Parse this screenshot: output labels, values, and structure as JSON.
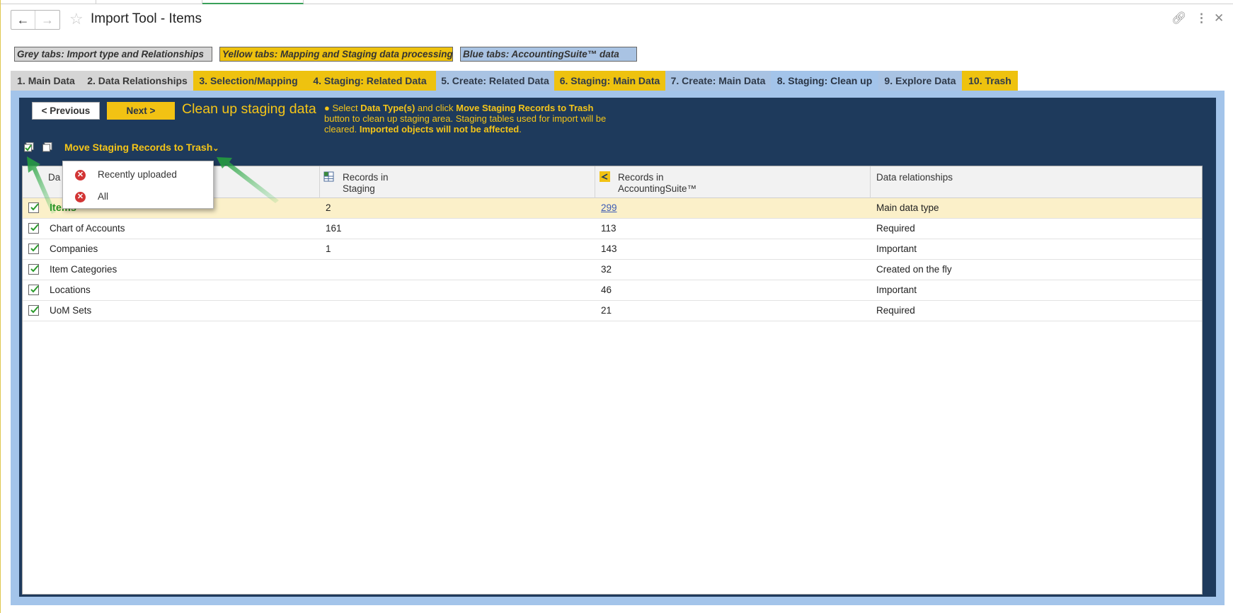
{
  "window": {
    "title": "Import Tool - Items"
  },
  "legend": {
    "grey": "Grey tabs: Import type and Relationships",
    "yellow": "Yellow tabs: Mapping and Staging data processing",
    "blue": "Blue tabs: AccountingSuite™ data"
  },
  "colors": {
    "grey_tab": "#d5d5d5",
    "yellow_tab": "#eec20f",
    "blue_tab": "#a9c3e3",
    "panel": "#1e3a5c",
    "accent": "#f5c518"
  },
  "tabs": [
    {
      "label": "1. Main Data",
      "color": "grey"
    },
    {
      "label": "2. Data Relationships",
      "color": "grey"
    },
    {
      "label": "3. Selection/Mapping",
      "color": "yellow"
    },
    {
      "label": "4. Staging: Related Data",
      "color": "yellow"
    },
    {
      "label": "5. Create: Related Data",
      "color": "blue"
    },
    {
      "label": "6. Staging: Main Data",
      "color": "yellow"
    },
    {
      "label": "7. Create: Main Data",
      "color": "blue"
    },
    {
      "label": "8. Staging: Clean up",
      "color": "active"
    },
    {
      "label": "9. Explore Data",
      "color": "blue"
    },
    {
      "label": "10. Trash",
      "color": "yellow"
    }
  ],
  "panel": {
    "previous_label": "< Previous",
    "next_label": "Next >",
    "title": "Clean up staging data",
    "help_bullet": "● Select",
    "help_strong1": "Data Type(s)",
    "help_text1": "and click",
    "help_strong2": "Move Staging Records to Trash",
    "help_text2": "button to clean up staging area. Staging tables used for import will be cleared.",
    "help_strong3": "Imported objects will not be affected",
    "help_end": "."
  },
  "toolbar": {
    "action_label": "Move Staging Records to Trash",
    "action_caret": "⌄"
  },
  "dropdown": {
    "items": [
      "Recently uploaded",
      "All"
    ]
  },
  "grid": {
    "headers": {
      "data_type_partial": "Da",
      "staging": "Records in Staging",
      "staging_line1": "Records in",
      "staging_line2": "Staging",
      "accountingsuite_line1": "Records in",
      "accountingsuite_line2": "AccountingSuite™",
      "relationships": "Data relationships"
    },
    "rows": [
      {
        "name": "Items",
        "staging": "2",
        "accountingsuite": "299",
        "relationship": "Main data type"
      },
      {
        "name": "Chart of Accounts",
        "staging": "161",
        "accountingsuite": "113",
        "relationship": "Required"
      },
      {
        "name": "Companies",
        "staging": "1",
        "accountingsuite": "143",
        "relationship": "Important"
      },
      {
        "name": "Item Categories",
        "staging": "",
        "accountingsuite": "32",
        "relationship": "Created on the fly"
      },
      {
        "name": "Locations",
        "staging": "",
        "accountingsuite": "46",
        "relationship": "Important"
      },
      {
        "name": "UoM Sets",
        "staging": "",
        "accountingsuite": "21",
        "relationship": "Required"
      }
    ]
  }
}
